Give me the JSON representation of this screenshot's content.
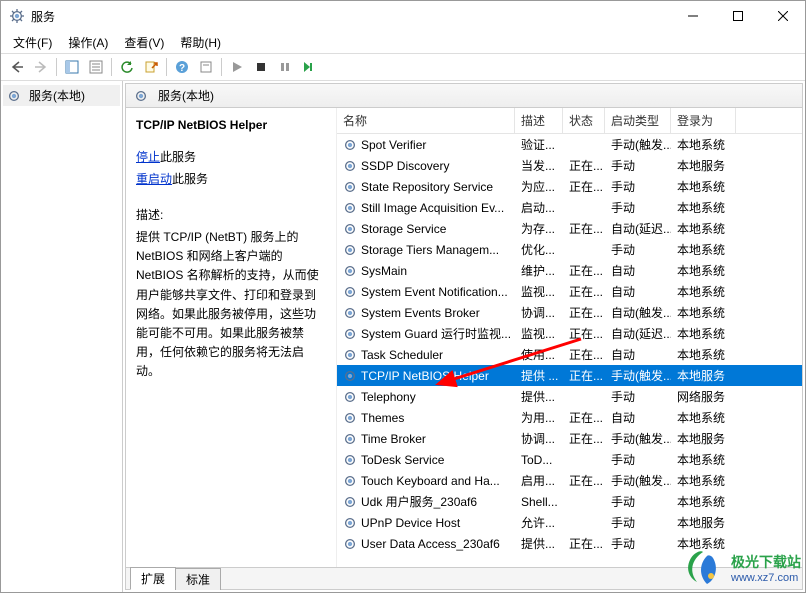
{
  "title": "服务",
  "menu": [
    "文件(F)",
    "操作(A)",
    "查看(V)",
    "帮助(H)"
  ],
  "tree_label": "服务(本地)",
  "right_header": "服务(本地)",
  "detail": {
    "title": "TCP/IP NetBIOS Helper",
    "stop": "停止",
    "stop_suffix": "此服务",
    "restart": "重启动",
    "restart_suffix": "此服务",
    "desc_label": "描述:",
    "desc": "提供 TCP/IP (NetBT) 服务上的 NetBIOS 和网络上客户端的 NetBIOS 名称解析的支持，从而使用户能够共享文件、打印和登录到网络。如果此服务被停用，这些功能可能不可用。如果此服务被禁用，任何依赖它的服务将无法启动。"
  },
  "columns": {
    "name": "名称",
    "desc": "描述",
    "status": "状态",
    "startup": "启动类型",
    "logon": "登录为"
  },
  "services": [
    {
      "name": "Spot Verifier",
      "desc": "验证...",
      "status": "",
      "startup": "手动(触发...",
      "logon": "本地系统"
    },
    {
      "name": "SSDP Discovery",
      "desc": "当发...",
      "status": "正在...",
      "startup": "手动",
      "logon": "本地服务"
    },
    {
      "name": "State Repository Service",
      "desc": "为应...",
      "status": "正在...",
      "startup": "手动",
      "logon": "本地系统"
    },
    {
      "name": "Still Image Acquisition Ev...",
      "desc": "启动...",
      "status": "",
      "startup": "手动",
      "logon": "本地系统"
    },
    {
      "name": "Storage Service",
      "desc": "为存...",
      "status": "正在...",
      "startup": "自动(延迟...",
      "logon": "本地系统"
    },
    {
      "name": "Storage Tiers Managem...",
      "desc": "优化...",
      "status": "",
      "startup": "手动",
      "logon": "本地系统"
    },
    {
      "name": "SysMain",
      "desc": "维护...",
      "status": "正在...",
      "startup": "自动",
      "logon": "本地系统"
    },
    {
      "name": "System Event Notification...",
      "desc": "监视...",
      "status": "正在...",
      "startup": "自动",
      "logon": "本地系统"
    },
    {
      "name": "System Events Broker",
      "desc": "协调...",
      "status": "正在...",
      "startup": "自动(触发...",
      "logon": "本地系统"
    },
    {
      "name": "System Guard 运行时监视...",
      "desc": "监视...",
      "status": "正在...",
      "startup": "自动(延迟...",
      "logon": "本地系统"
    },
    {
      "name": "Task Scheduler",
      "desc": "使用...",
      "status": "正在...",
      "startup": "自动",
      "logon": "本地系统"
    },
    {
      "name": "TCP/IP NetBIOS Helper",
      "desc": "提供 ...",
      "status": "正在...",
      "startup": "手动(触发...",
      "logon": "本地服务",
      "selected": true
    },
    {
      "name": "Telephony",
      "desc": "提供...",
      "status": "",
      "startup": "手动",
      "logon": "网络服务"
    },
    {
      "name": "Themes",
      "desc": "为用...",
      "status": "正在...",
      "startup": "自动",
      "logon": "本地系统"
    },
    {
      "name": "Time Broker",
      "desc": "协调...",
      "status": "正在...",
      "startup": "手动(触发...",
      "logon": "本地服务"
    },
    {
      "name": "ToDesk Service",
      "desc": "ToD...",
      "status": "",
      "startup": "手动",
      "logon": "本地系统"
    },
    {
      "name": "Touch Keyboard and Ha...",
      "desc": "启用...",
      "status": "正在...",
      "startup": "手动(触发...",
      "logon": "本地系统"
    },
    {
      "name": "Udk 用户服务_230af6",
      "desc": "Shell...",
      "status": "",
      "startup": "手动",
      "logon": "本地系统"
    },
    {
      "name": "UPnP Device Host",
      "desc": "允许...",
      "status": "",
      "startup": "手动",
      "logon": "本地服务"
    },
    {
      "name": "User Data Access_230af6",
      "desc": "提供...",
      "status": "正在...",
      "startup": "手动",
      "logon": "本地系统"
    }
  ],
  "tabs": [
    "扩展",
    "标准"
  ],
  "watermark": {
    "line1": "极光下载站",
    "line2": "www.xz7.com"
  }
}
